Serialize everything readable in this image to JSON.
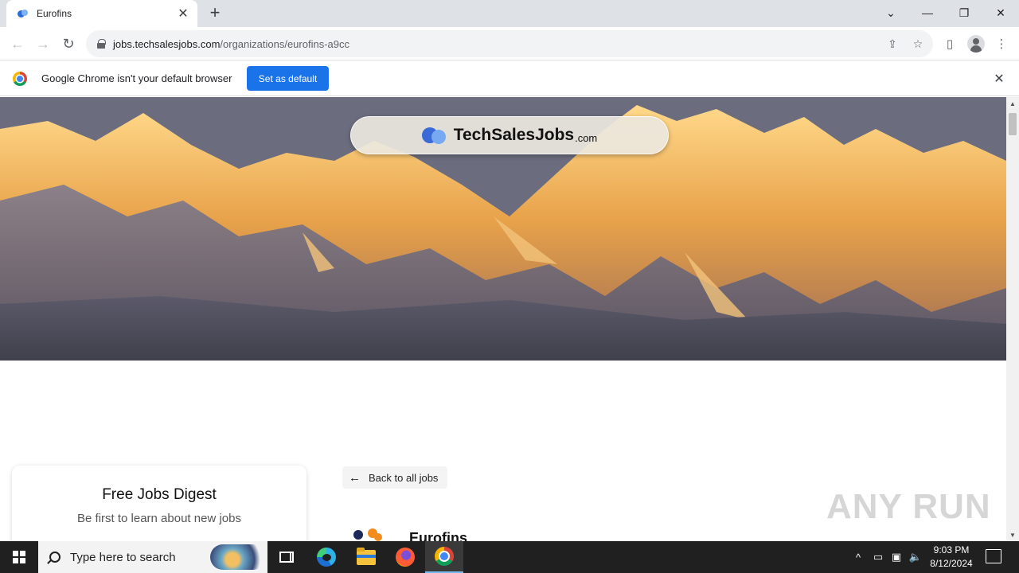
{
  "browser": {
    "tab": {
      "title": "Eurofins",
      "close_glyph": "✕",
      "favicon": "techsalesjobs-favicon-icon"
    },
    "new_tab_glyph": "+",
    "window_controls": {
      "list": "⌄",
      "minimize": "—",
      "restore": "❐",
      "close": "✕"
    },
    "url": {
      "host": "jobs.techsalesjobs.com",
      "path": "/organizations/eurofins-a9cc"
    },
    "nav": {
      "back": "←",
      "forward": "→",
      "reload": "↻"
    },
    "toolbar_icons": {
      "share": "⇪",
      "bookmark": "☆",
      "sidepanel": "▯",
      "menu": "⋮"
    }
  },
  "infobar": {
    "message": "Google Chrome isn't your default browser",
    "button": "Set as default",
    "close": "✕"
  },
  "page": {
    "brand": {
      "name": "TechSalesJobs",
      "tld": ".com"
    },
    "digest": {
      "title": "Free Jobs Digest",
      "subtitle": "Be first to learn about new jobs"
    },
    "back": {
      "arrow": "←",
      "label": "Back to all jobs"
    },
    "organization": {
      "name": "Eurofins"
    },
    "watermark": "ANY RUN"
  },
  "scrollbar": {
    "up": "▲",
    "down": "▼"
  },
  "taskbar": {
    "search_placeholder": "Type here to search",
    "clock": {
      "time": "9:03 PM",
      "date": "8/12/2024"
    },
    "tray": {
      "chevron": "^",
      "speaker": "🔈"
    }
  },
  "colors": {
    "accent": "#1a73e8",
    "taskbar": "#202020",
    "tab_strip": "#dee1e6"
  }
}
